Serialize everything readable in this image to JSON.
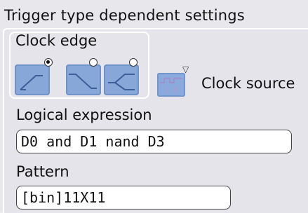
{
  "header": {
    "title": "Trigger type dependent settings"
  },
  "clock_edge": {
    "label": "Clock edge",
    "options": [
      {
        "name": "rising",
        "selected": true
      },
      {
        "name": "falling",
        "selected": false
      },
      {
        "name": "either",
        "selected": false
      }
    ]
  },
  "clock_source": {
    "label": "Clock source",
    "icon_bits": "1.0"
  },
  "logical_expression": {
    "label": "Logical expression",
    "value": "D0 and D1 nand D3"
  },
  "pattern": {
    "label": "Pattern",
    "value": "[bin]11X11"
  },
  "colors": {
    "button_blue": "#86a7d8",
    "field_bg": "#ffffff",
    "panel_bg": "#e8e8ec"
  }
}
